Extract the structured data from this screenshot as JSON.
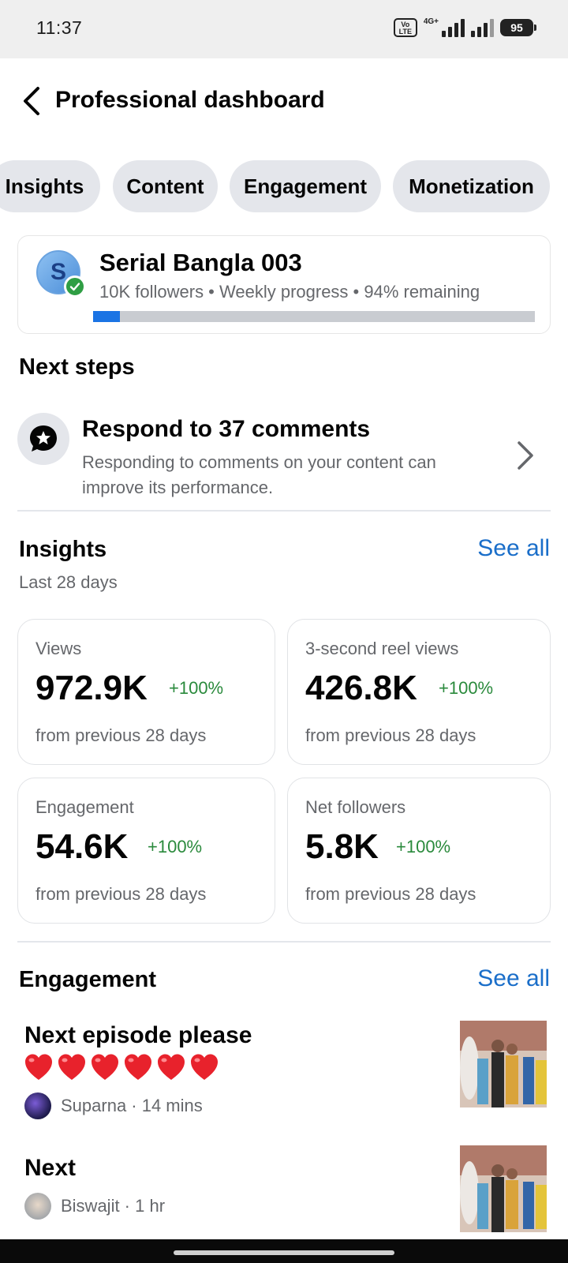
{
  "status_bar": {
    "time": "11:37",
    "network_label": "4G+",
    "volte_label": "Vo LTE",
    "battery": "95"
  },
  "header": {
    "title": "Professional dashboard"
  },
  "tabs": [
    {
      "label": "Insights"
    },
    {
      "label": "Content"
    },
    {
      "label": "Engagement"
    },
    {
      "label": "Monetization"
    }
  ],
  "profile": {
    "avatar_letter": "S",
    "name": "Serial Bangla 003",
    "meta": "10K followers • Weekly progress • 94% remaining",
    "progress_fraction": 0.06,
    "accent": "#1b74e4"
  },
  "next_steps": {
    "title": "Next steps",
    "item": {
      "title": "Respond to 37 comments",
      "description": "Responding to comments on your content can improve its performance."
    }
  },
  "insights": {
    "title": "Insights",
    "see_all": "See all",
    "period": "Last 28 days",
    "cards": [
      {
        "label": "Views",
        "value": "972.9K",
        "change": "+100%",
        "note": "from previous 28 days"
      },
      {
        "label": "3-second reel views",
        "value": "426.8K",
        "change": "+100%",
        "note": "from previous 28 days"
      },
      {
        "label": "Engagement",
        "value": "54.6K",
        "change": "+100%",
        "note": "from previous 28 days"
      },
      {
        "label": "Net followers",
        "value": "5.8K",
        "change": "+100%",
        "note": "from previous 28 days"
      }
    ]
  },
  "engagement": {
    "title": "Engagement",
    "see_all": "See all",
    "comments": [
      {
        "text": "Next episode please",
        "hearts": 6,
        "author": "Suparna · 14 mins"
      },
      {
        "text": "Next",
        "hearts": 0,
        "author": "Biswajit · 1 hr"
      }
    ]
  },
  "colors": {
    "positive": "#2a8a3c",
    "link": "#1a6ec9",
    "verified": "#2f9e44"
  }
}
